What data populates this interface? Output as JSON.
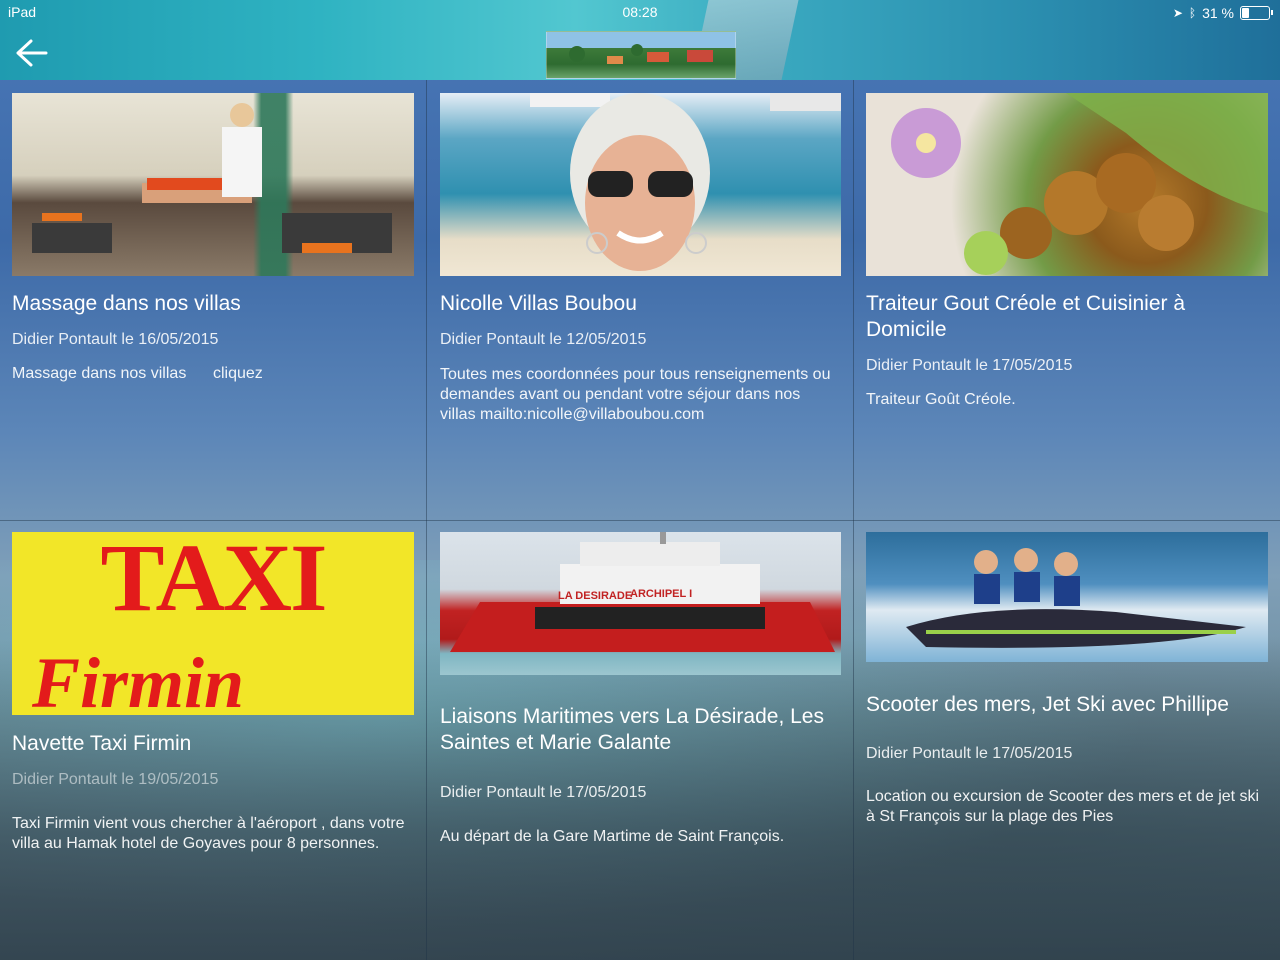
{
  "status_bar": {
    "device": "iPad",
    "time": "08:28",
    "battery": "31 %",
    "battery_level_percent": 31
  },
  "header": {
    "back_icon": "back-arrow-icon",
    "thumbnail": "resort-thumbnail"
  },
  "cards": [
    {
      "title": "Massage dans nos villas",
      "meta": "Didier Pontault le 16/05/2015",
      "desc": "Massage dans nos villas      cliquez",
      "image": "massage-photo"
    },
    {
      "title": "Nicolle Villas Boubou",
      "meta": "Didier Pontault le 12/05/2015",
      "desc": "Toutes mes coordonnées pour tous renseignements ou  demandes  avant ou pendant votre séjour dans nos villas mailto:nicolle@villaboubou.com",
      "image": "nicolle-photo"
    },
    {
      "title": "Traiteur Gout Créole et Cuisinier à Domicile",
      "meta": "Didier Pontault le 17/05/2015",
      "desc": "Traiteur Goût Créole.",
      "image": "creole-food-photo"
    },
    {
      "title": "Navette Taxi Firmin",
      "meta": "Didier Pontault le 19/05/2015",
      "desc": "Taxi Firmin vient vous chercher à  l'aéroport  , dans votre villa au Hamak hotel de Goyaves pour 8 personnes.",
      "image": "taxi-sign-photo",
      "image_text_1": "TAXI",
      "image_text_2": "Firmin"
    },
    {
      "title": "Liaisons Maritimes vers La Désirade, Les Saintes et Marie Galante",
      "meta": "Didier Pontault le 17/05/2015",
      "desc": "Au départ de la Gare Martime de Saint François.",
      "image": "ferry-photo",
      "image_text_1": "LA DESIRADE",
      "image_text_2": "ARCHIPEL I"
    },
    {
      "title": "Scooter des mers, Jet Ski avec Phillipe",
      "meta": "Didier Pontault le 17/05/2015",
      "desc": "Location ou excursion de Scooter des mers et de jet ski à St François sur la plage des Pies",
      "image": "jetski-photo"
    }
  ]
}
